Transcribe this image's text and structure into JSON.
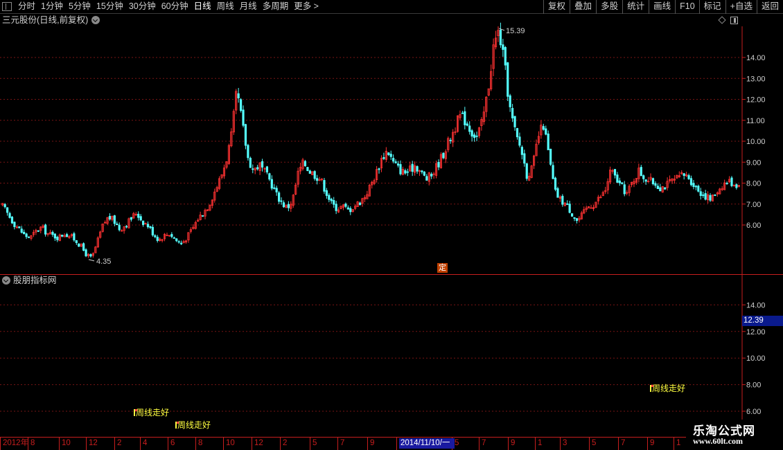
{
  "toolbar": {
    "tabs": [
      "分时",
      "1分钟",
      "5分钟",
      "15分钟",
      "30分钟",
      "60分钟",
      "日线",
      "周线",
      "月线",
      "多周期",
      "更多 >"
    ],
    "active_tab": "日线",
    "buttons": [
      "复权",
      "叠加",
      "多股",
      "统计",
      "画线",
      "F10",
      "标记",
      "+自选",
      "返回"
    ]
  },
  "main_panel": {
    "title": "三元股份(日线,前复权)",
    "high_label": "15.39",
    "low_label": "4.35",
    "ding_badge": "定"
  },
  "indicator_panel": {
    "title": "股朋指标网",
    "cursor_value": "12.39",
    "signals": [
      "周线走好",
      "周线走好",
      "周线走好"
    ]
  },
  "date_axis": {
    "ticks": [
      "2012年",
      "8",
      "10",
      "12",
      "2",
      "4",
      "6",
      "8",
      "10",
      "12",
      "2",
      "5",
      "7",
      "9",
      "1",
      "5",
      "7",
      "9",
      "1",
      "3",
      "5",
      "7",
      "9",
      "1"
    ],
    "cursor_label": "2014/11/10/一"
  },
  "watermark": {
    "title": "乐淘公式网",
    "url": "www.60lt.com"
  },
  "colors": {
    "background": "#000000",
    "grid": "#7a1414",
    "axis": "#c81e1e",
    "up_candle": "#ff3232",
    "down_candle": "#54ffff",
    "signal": "#ffff40",
    "cursor": "#1a1aa0"
  },
  "chart_data": [
    {
      "type": "candlestick",
      "title": "三元股份(日线,前复权)",
      "y_ticks": [
        6.0,
        7.0,
        8.0,
        9.0,
        10.0,
        11.0,
        12.0,
        13.0,
        14.0
      ],
      "y_tick_labels": [
        "6.00",
        "7.00",
        "8.00",
        "9.00",
        "10.00",
        "11.00",
        "12.00",
        "13.00",
        "14.00"
      ],
      "ylim": [
        4.35,
        15.39
      ],
      "annotations": [
        {
          "label": "15.39",
          "type": "high"
        },
        {
          "label": "4.35",
          "type": "low"
        }
      ],
      "close_path": [
        6.9,
        6.5,
        6.1,
        5.8,
        5.5,
        5.4,
        5.7,
        5.9,
        5.6,
        5.5,
        5.4,
        5.6,
        5.5,
        5.3,
        5.0,
        4.6,
        4.4,
        5.2,
        6.0,
        6.4,
        6.2,
        5.8,
        6.0,
        6.3,
        6.6,
        6.2,
        6.0,
        5.6,
        5.3,
        5.5,
        5.6,
        5.3,
        5.1,
        5.4,
        5.8,
        6.3,
        6.6,
        7.0,
        7.6,
        8.2,
        9.0,
        10.2,
        12.4,
        10.8,
        9.2,
        8.6,
        8.9,
        8.5,
        8.1,
        7.5,
        7.1,
        6.8,
        7.2,
        8.5,
        9.0,
        8.6,
        8.4,
        8.2,
        7.6,
        7.0,
        6.8,
        6.9,
        6.7,
        6.9,
        7.1,
        7.4,
        7.9,
        8.5,
        9.2,
        9.6,
        9.0,
        8.7,
        8.5,
        8.6,
        8.9,
        8.5,
        8.2,
        8.4,
        8.9,
        9.4,
        10.0,
        10.6,
        11.2,
        11.0,
        10.5,
        10.2,
        10.9,
        12.4,
        14.5,
        15.3,
        13.6,
        11.5,
        10.3,
        9.6,
        8.4,
        8.7,
        10.2,
        10.8,
        9.2,
        7.6,
        7.2,
        7.0,
        6.6,
        6.2,
        6.5,
        6.9,
        7.0,
        7.3,
        7.6,
        8.6,
        8.2,
        7.8,
        7.5,
        8.1,
        8.6,
        8.3,
        8.1,
        8.0,
        7.8,
        7.9,
        8.1,
        8.2,
        8.4,
        8.3,
        7.9,
        7.6,
        7.4,
        7.2,
        7.6,
        7.9,
        8.1,
        8.0,
        7.9
      ]
    },
    {
      "type": "indicator",
      "title": "股朋指标网",
      "y_ticks": [
        6.0,
        8.0,
        10.0,
        12.0,
        14.0
      ],
      "y_tick_labels": [
        "6.00",
        "8.00",
        "10.00",
        "12.00",
        "14.00"
      ],
      "signals": [
        {
          "label": "周线走好",
          "y": 6.05
        },
        {
          "label": "周线走好",
          "y": 5.1
        },
        {
          "label": "周线走好",
          "y": 7.85
        }
      ]
    }
  ]
}
